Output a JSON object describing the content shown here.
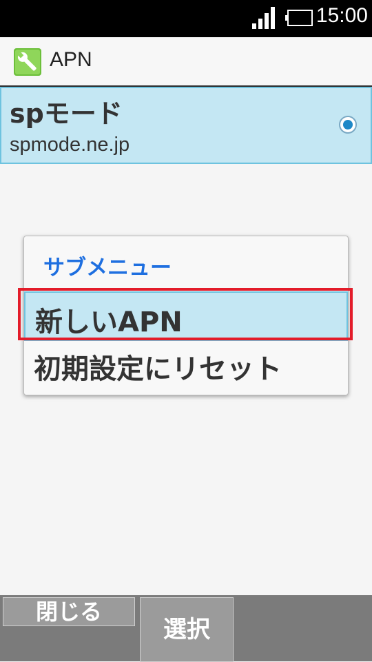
{
  "status_bar": {
    "time": "15:00"
  },
  "header": {
    "title": "APN",
    "icon": "wrench-settings-icon"
  },
  "apn_list": [
    {
      "name": "spモード",
      "apn": "spmode.ne.jp",
      "selected": true
    }
  ],
  "dialog": {
    "title": "サブメニュー",
    "items": [
      {
        "label": "新しいAPN",
        "highlighted": true
      },
      {
        "label": "初期設定にリセット",
        "highlighted": false
      }
    ]
  },
  "softkeys": {
    "close": "閉じる",
    "select": "選択"
  },
  "colors": {
    "selection_bg": "#c4e7f3",
    "accent_blue": "#1e6fe0",
    "highlight_red": "#e31c2a"
  }
}
